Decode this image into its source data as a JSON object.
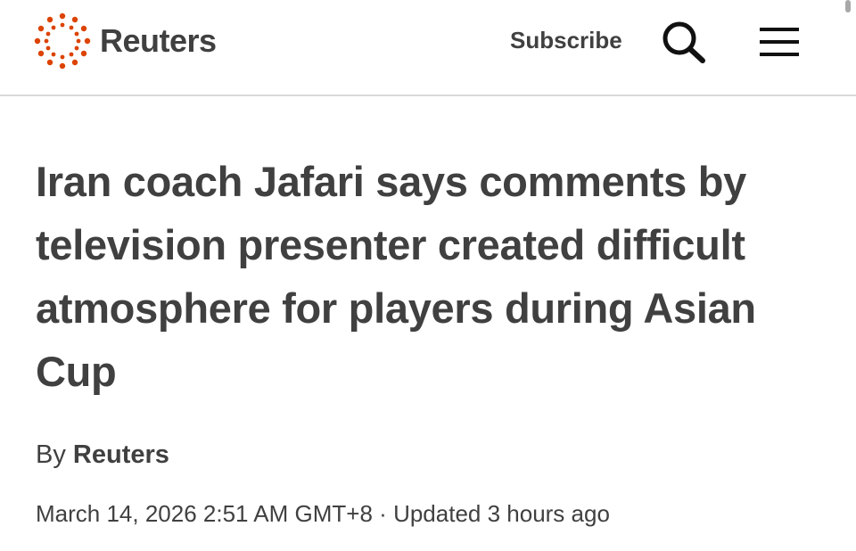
{
  "header": {
    "logo_text": "Reuters",
    "subscribe_label": "Subscribe",
    "search_icon": "search-icon",
    "menu_icon": "hamburger-menu-icon",
    "brand_color": "#dc4300",
    "text_color": "#404040"
  },
  "article": {
    "headline": "Iran coach Jafari says comments by television presenter created difficult atmosphere for players during Asian Cup",
    "byline_prefix": "By",
    "author": "Reuters",
    "date": "March 14, 2026 2:51 AM GMT+8",
    "separator": "·",
    "updated": "Updated 3 hours ago"
  }
}
